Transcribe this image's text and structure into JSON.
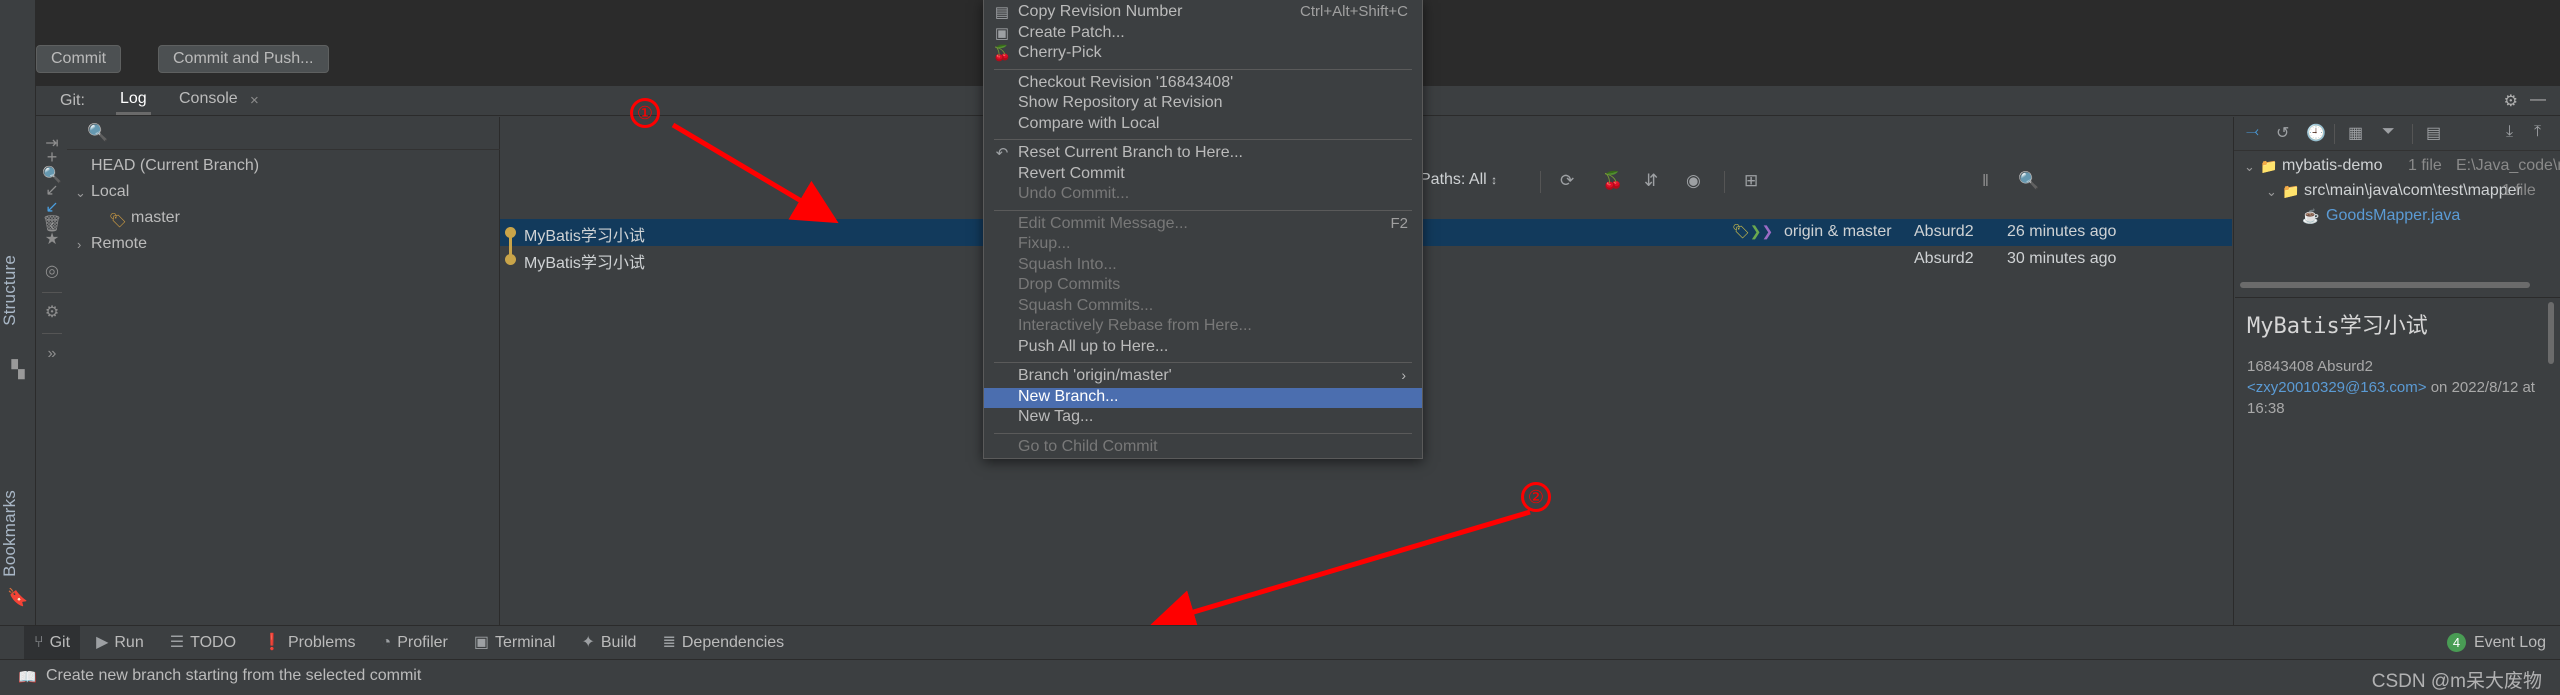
{
  "window": {
    "bg_color": "#3c3f41",
    "accent_blue": "#4b6eaf",
    "selection_blue": "#123a5c"
  },
  "commit_toolbar": {
    "commit_label": "Commit",
    "commit_and_push_label": "Commit and Push..."
  },
  "git_toolwindow": {
    "prefix_label": "Git:",
    "tabs": [
      {
        "label": "Log",
        "active": true
      },
      {
        "label": "Console",
        "active": false
      }
    ],
    "close_icon": "×",
    "gear_icon": "⚙",
    "minimize_icon": "—"
  },
  "left_tool_strip": {
    "items": [
      {
        "label": "Structure",
        "icon": "structure-icon"
      },
      {
        "label": "Bookmarks",
        "icon": "bookmark-icon"
      }
    ]
  },
  "icon_column": {
    "icons": [
      "collapse-icon",
      "search-icon",
      "go-to-icon",
      "star-icon",
      "target-icon",
      "settings-icon",
      "more-icon"
    ]
  },
  "branch_panel": {
    "search_placeholder": "",
    "collapse_icon": "‹",
    "side_icons": [
      "plus-icon",
      "import-icon",
      "trash-icon"
    ],
    "tree": [
      {
        "label": "HEAD (Current Branch)",
        "indent": 0,
        "chevron": "",
        "icon": ""
      },
      {
        "label": "Local",
        "indent": 0,
        "chevron": "⌄",
        "icon": ""
      },
      {
        "label": "master",
        "indent": 1,
        "chevron": "",
        "icon": "tag-icon"
      },
      {
        "label": "Remote",
        "indent": 0,
        "chevron": "›",
        "icon": ""
      }
    ]
  },
  "commit_graph": {
    "rows": [
      {
        "message": "MyBatis学习小试",
        "selected": true
      },
      {
        "message": "MyBatis学习小试",
        "selected": false
      }
    ]
  },
  "log_toolbar": {
    "paths_label": "Paths: All",
    "paths_arrow": "↕",
    "icons": [
      "refresh-icon",
      "cherry-pick-icon",
      "sort-icon",
      "eye-icon",
      "collapse-panel-icon"
    ],
    "pause_icon": "‖",
    "search_icon": "search-icon"
  },
  "commit_meta_rows": [
    {
      "refs": "origin & master",
      "author": "Absurd2",
      "date": "26 minutes ago",
      "selected": true
    },
    {
      "refs": "",
      "author": "Absurd2",
      "date": "30 minutes ago",
      "selected": false
    }
  ],
  "details_panel": {
    "toolbar_icons": [
      "expand-selection-icon",
      "revert-icon",
      "history-icon",
      "group-by-icon",
      "filter-icon",
      "view-options-icon",
      "expand-all-icon",
      "collapse-all-icon"
    ],
    "file_tree": [
      {
        "name": "mybatis-demo",
        "meta": "1 file",
        "path": "E:\\Java_code\\maven\\mybatis-d",
        "indent": 0,
        "chevron": "⌄",
        "icon": "module-icon",
        "style": "white"
      },
      {
        "name": "src\\main\\java\\com\\test\\mapper",
        "meta": "1 file",
        "path": "",
        "indent": 1,
        "chevron": "⌄",
        "icon": "folder-icon",
        "style": "white"
      },
      {
        "name": "GoodsMapper.java",
        "meta": "",
        "path": "",
        "indent": 2,
        "chevron": "",
        "icon": "java-file-icon",
        "style": "blue"
      }
    ],
    "commit_message": "MyBatis学习小试",
    "commit_hash": "16843408",
    "commit_author": "Absurd2",
    "commit_email": "<zxy20010329@163.com>",
    "commit_on_word": "on",
    "commit_date": "2022/8/12 at 16:38"
  },
  "context_menu": {
    "items": [
      {
        "label": "Copy Revision Number",
        "accel": "Ctrl+Alt+Shift+C",
        "icon": "copy-icon",
        "state": "normal"
      },
      {
        "label": "Create Patch...",
        "accel": "",
        "icon": "patch-icon",
        "state": "normal"
      },
      {
        "label": "Cherry-Pick",
        "accel": "",
        "icon": "cherry-pick-icon",
        "state": "normal"
      },
      {
        "separator": true
      },
      {
        "label": "Checkout Revision '16843408'",
        "accel": "",
        "icon": "",
        "state": "normal"
      },
      {
        "label": "Show Repository at Revision",
        "accel": "",
        "icon": "",
        "state": "normal"
      },
      {
        "label": "Compare with Local",
        "accel": "",
        "icon": "",
        "state": "normal"
      },
      {
        "separator": true
      },
      {
        "label": "Reset Current Branch to Here...",
        "accel": "",
        "icon": "undo-icon",
        "state": "normal"
      },
      {
        "label": "Revert Commit",
        "accel": "",
        "icon": "",
        "state": "normal"
      },
      {
        "label": "Undo Commit...",
        "accel": "",
        "icon": "",
        "state": "disabled"
      },
      {
        "separator": true
      },
      {
        "label": "Edit Commit Message...",
        "accel": "F2",
        "icon": "",
        "state": "disabled"
      },
      {
        "label": "Fixup...",
        "accel": "",
        "icon": "",
        "state": "disabled"
      },
      {
        "label": "Squash Into...",
        "accel": "",
        "icon": "",
        "state": "disabled"
      },
      {
        "label": "Drop Commits",
        "accel": "",
        "icon": "",
        "state": "disabled"
      },
      {
        "label": "Squash Commits...",
        "accel": "",
        "icon": "",
        "state": "disabled"
      },
      {
        "label": "Interactively Rebase from Here...",
        "accel": "",
        "icon": "",
        "state": "disabled"
      },
      {
        "label": "Push All up to Here...",
        "accel": "",
        "icon": "",
        "state": "normal"
      },
      {
        "separator": true
      },
      {
        "label": "Branch 'origin/master'",
        "accel": "",
        "icon": "",
        "state": "normal",
        "submenu": true
      },
      {
        "label": "New Branch...",
        "accel": "",
        "icon": "",
        "state": "highlighted"
      },
      {
        "label": "New Tag...",
        "accel": "",
        "icon": "",
        "state": "normal"
      },
      {
        "separator": true
      },
      {
        "label": "Go to Child Commit",
        "accel": "",
        "icon": "",
        "state": "disabled"
      }
    ]
  },
  "annotations": [
    {
      "number": "①"
    },
    {
      "number": "②"
    }
  ],
  "bottom_toolwindows": [
    {
      "label": "Git",
      "glyph": "⑂",
      "active": true
    },
    {
      "label": "Run",
      "glyph": "▶",
      "active": false
    },
    {
      "label": "TODO",
      "glyph": "☰",
      "active": false
    },
    {
      "label": "Problems",
      "glyph": "❗",
      "active": false
    },
    {
      "label": "Profiler",
      "glyph": "◔",
      "active": false
    },
    {
      "label": "Terminal",
      "glyph": "▣",
      "active": false
    },
    {
      "label": "Build",
      "glyph": "✦",
      "active": false
    },
    {
      "label": "Dependencies",
      "glyph": "≣",
      "active": false
    }
  ],
  "event_log": {
    "count": "4",
    "label": "Event Log"
  },
  "status_bar": {
    "message": "Create new branch starting from the selected commit",
    "icon": "book-icon"
  },
  "watermark": {
    "text": "CSDN @m呆大废物"
  }
}
